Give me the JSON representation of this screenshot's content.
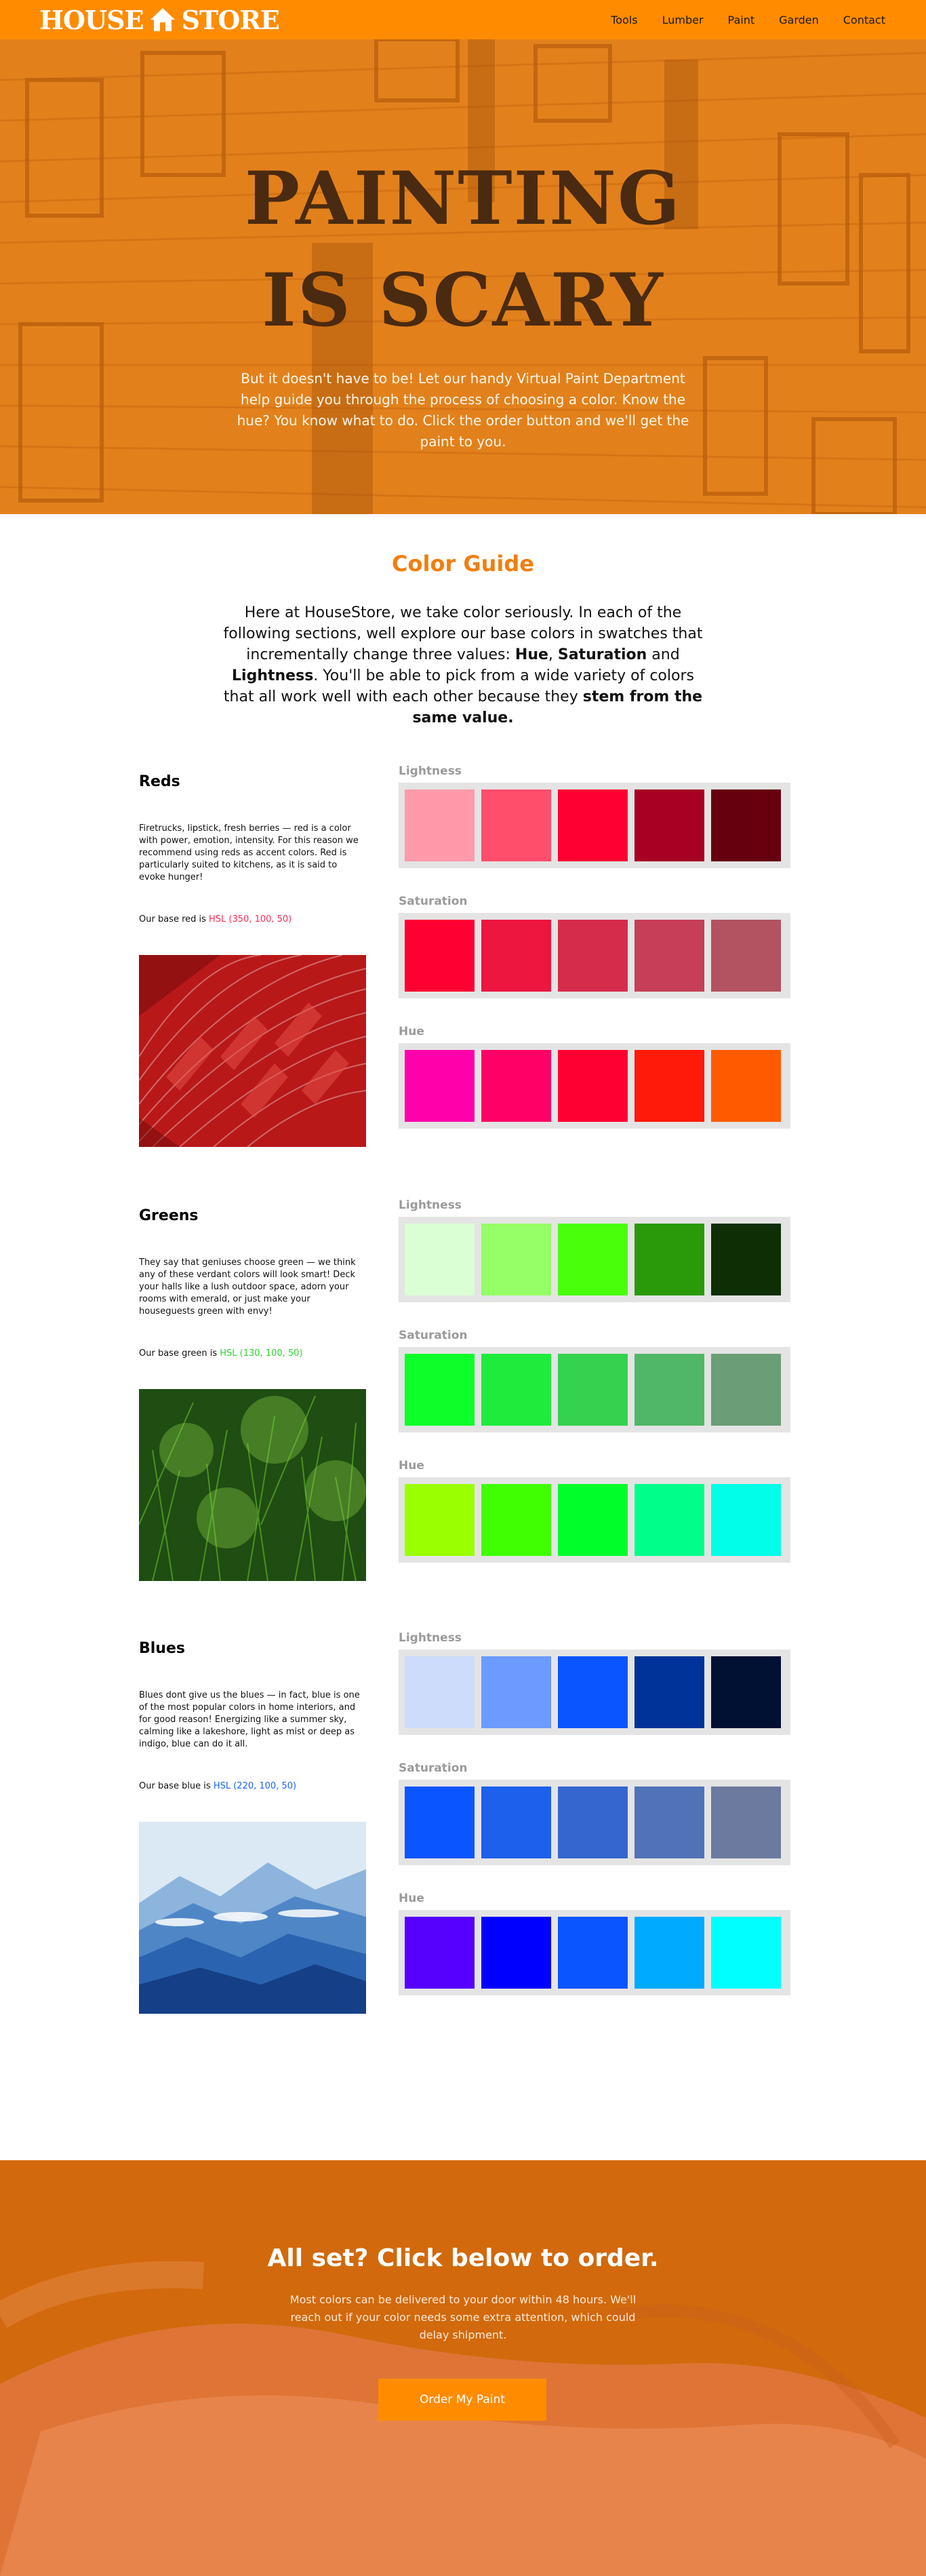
{
  "header": {
    "logo_left": "HOUSE",
    "logo_right": "STORE",
    "nav": [
      "Tools",
      "Lumber",
      "Paint",
      "Garden",
      "Contact"
    ]
  },
  "hero": {
    "title": "Painting is scary",
    "subtitle": "But it doesn't have to be! Let our handy Virtual Paint Department help guide you through the process of choosing a color. Know the hue? You know what to do. Click the order button and we'll get the paint to you."
  },
  "guide": {
    "title": "Color Guide",
    "text_1": "Here at HouseStore, we take color seriously. In each of the following sections, well explore our base colors in swatches that incrementally change three values: ",
    "hue": "Hue",
    "sep_1": ", ",
    "saturation": "Saturation",
    "sep_2": " and ",
    "lightness": "Lightness",
    "text_2": ". You'll be able to pick from a wide variety of colors that all work well with each other because they ",
    "emphasis": "stem from the same value."
  },
  "labels": {
    "lightness": "Lightness",
    "saturation": "Saturation",
    "hue": "Hue"
  },
  "sections": [
    {
      "title": "Reds",
      "description": "Firetrucks, lipstick, fresh berries — red is a color with power, emotion, intensity. For this reason we recommend using reds as accent colors. Red is particularly suited to kitchens, as it is said to evoke hunger!",
      "base_prefix": "Our base red is ",
      "base_value": "HSL (350, 100, 50)",
      "base_color": "#ff2a55",
      "photo": "red-tiles-photo",
      "lightness": [
        "#ff9aab",
        "#ff4d6c",
        "#ff0033",
        "#a80022",
        "#66000f"
      ],
      "saturation": [
        "#ff0033",
        "#ec163f",
        "#d62c4c",
        "#c63e57",
        "#b35260"
      ],
      "hue": [
        "#ff00aa",
        "#ff0066",
        "#ff0033",
        "#ff1a0a",
        "#ff5a00"
      ]
    },
    {
      "title": "Greens",
      "description": "They say that geniuses choose green — we think any of these verdant colors will look smart! Deck your halls like a lush outdoor space, adorn your rooms with emerald, or just make your houseguests green with envy!",
      "base_prefix": "Our base green is ",
      "base_value": "HSL (130, 100, 50)",
      "base_color": "#2bd42b",
      "photo": "green-grass-photo",
      "lightness": [
        "#dbffd4",
        "#94ff66",
        "#4aff0a",
        "#2a9a0a",
        "#0e2e05"
      ],
      "saturation": [
        "#0dff2a",
        "#1feb3d",
        "#35d250",
        "#50b766",
        "#6a9e76"
      ],
      "hue": [
        "#9aff00",
        "#40ff00",
        "#00ff2a",
        "#00ff8a",
        "#00ffe6"
      ]
    },
    {
      "title": "Blues",
      "description": "Blues dont give us the blues — in fact, blue is one of the most popular colors in home interiors, and for good reason! Energizing like a summer sky, calming like a lakeshore, light as mist or deep as indigo, blue can do it all.",
      "base_prefix": "Our base blue is ",
      "base_value": "HSL (220, 100, 50)",
      "base_color": "#1a63f0",
      "photo": "blue-mountains-photo",
      "lightness": [
        "#cddcfb",
        "#6b9bff",
        "#0a55ff",
        "#003399",
        "#001133"
      ],
      "saturation": [
        "#0a55ff",
        "#1c60eb",
        "#3566cf",
        "#5073b8",
        "#6b7a9e"
      ],
      "hue": [
        "#5500ff",
        "#0000ff",
        "#0a55ff",
        "#00aaff",
        "#00ffff"
      ]
    }
  ],
  "footer": {
    "title": "All set? Click below to order.",
    "text": "Most colors can be delivered to your door within 48 hours. We'll reach out if your color needs some extra attention, which could delay shipment.",
    "button": "Order My Paint"
  }
}
